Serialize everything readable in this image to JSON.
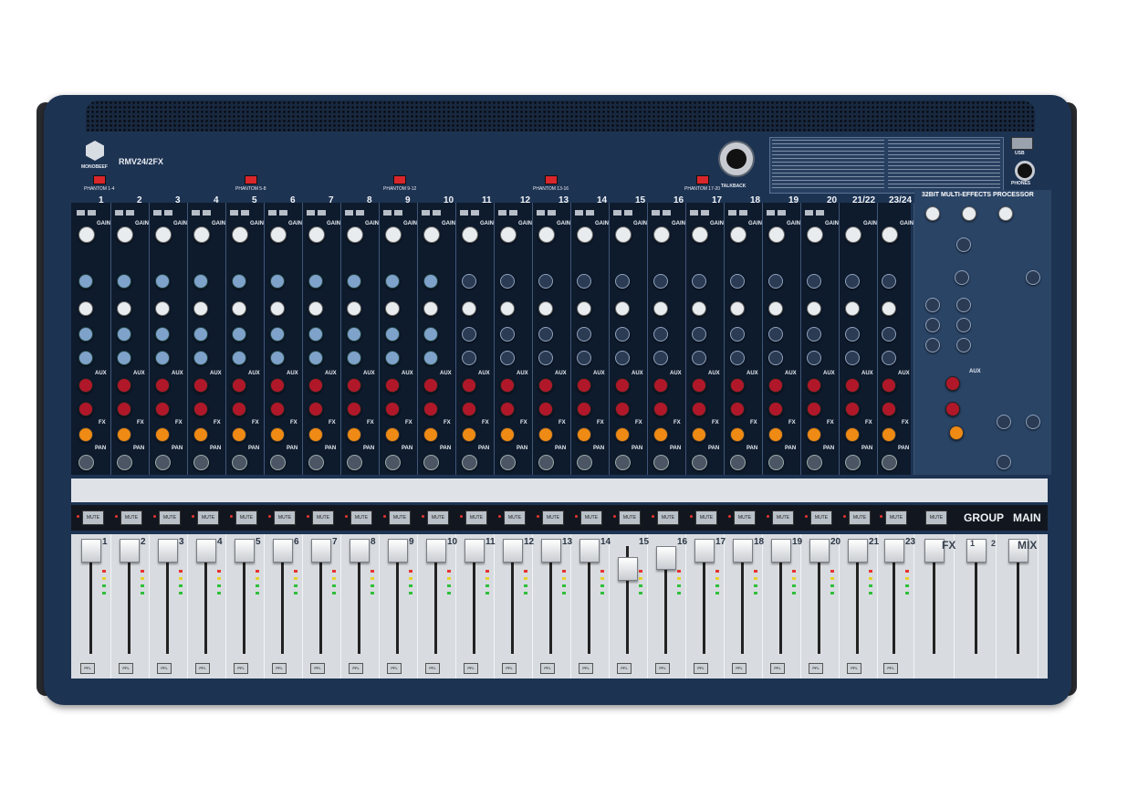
{
  "brand": {
    "model": "RMV24/2FX",
    "logo_text": "MONOBEEF"
  },
  "phantom_labels": [
    "PHANTOM 1-4",
    "PHANTOM 5-8",
    "PHANTOM 9-12",
    "PHANTOM 13-16",
    "PHANTOM 17-20"
  ],
  "talkback_label": "TALKBACK",
  "usb_label": "USB",
  "phones_label": "PHONES",
  "channels": [
    "1",
    "2",
    "3",
    "4",
    "5",
    "6",
    "7",
    "8",
    "9",
    "10",
    "11",
    "12",
    "13",
    "14",
    "15",
    "16",
    "17",
    "18",
    "19",
    "20",
    "21/22",
    "23/24"
  ],
  "fader_numbers": [
    "1",
    "2",
    "3",
    "4",
    "5",
    "6",
    "7",
    "8",
    "9",
    "10",
    "11",
    "12",
    "13",
    "14",
    "15",
    "16",
    "17",
    "18",
    "19",
    "20",
    "21",
    "23"
  ],
  "strip_labels": {
    "gain": "GAIN",
    "aux": "AUX",
    "fx": "FX",
    "pan": "PAN",
    "pfl": "PFL",
    "mute": "MUTE"
  },
  "fx_processor_title": "32BIT MULTI-EFFECTS PROCESSOR",
  "section_headers": {
    "fx": "FX",
    "group": "GROUP",
    "main": "MAIN",
    "mix": "MIX",
    "aux": "AUX"
  },
  "fx_group_numbers": [
    "1",
    "2"
  ],
  "colors": {
    "body": "#1d3352",
    "aux_knob": "#b0182a",
    "fx_knob": "#ef8a14",
    "eq_knob": "#7ea2c9",
    "phantom_button": "#d9262b"
  }
}
